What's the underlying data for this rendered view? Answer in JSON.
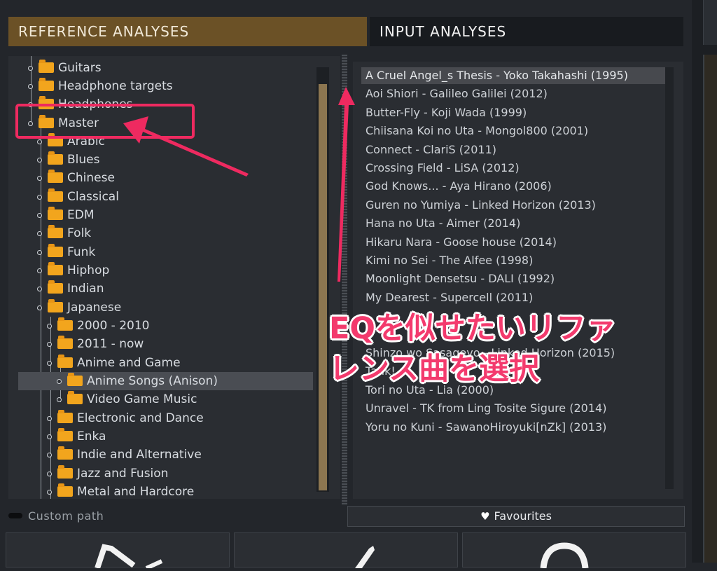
{
  "tabs": {
    "reference": "REFERENCE ANALYSES",
    "input": "INPUT ANALYSES"
  },
  "tree": {
    "items": [
      {
        "label": "Guitars"
      },
      {
        "label": "Headphone targets"
      },
      {
        "label": "Headphones"
      },
      {
        "label": "Master"
      },
      {
        "label": "Arabic"
      },
      {
        "label": "Blues"
      },
      {
        "label": "Chinese"
      },
      {
        "label": "Classical"
      },
      {
        "label": "EDM"
      },
      {
        "label": "Folk"
      },
      {
        "label": "Funk"
      },
      {
        "label": "Hiphop"
      },
      {
        "label": "Indian"
      },
      {
        "label": "Japanese"
      },
      {
        "label": "2000 - 2010"
      },
      {
        "label": "2011 - now"
      },
      {
        "label": "Anime and Game"
      },
      {
        "label": "Anime Songs (Anison)"
      },
      {
        "label": "Video Game Music"
      },
      {
        "label": "Electronic and Dance"
      },
      {
        "label": "Enka"
      },
      {
        "label": "Indie and Alternative"
      },
      {
        "label": "Jazz and Fusion"
      },
      {
        "label": "Metal and Hardcore"
      }
    ]
  },
  "songs": [
    "A Cruel Angel_s Thesis - Yoko Takahashi (1995)",
    "Aoi Shiori - Galileo Galilei (2012)",
    "Butter-Fly - Koji Wada (1999)",
    "Chiisana Koi no Uta - Mongol800 (2001)",
    "Connect - ClariS (2011)",
    "Crossing Field - LiSA (2012)",
    "God Knows... - Aya Hirano (2006)",
    "Guren no Yumiya - Linked Horizon (2013)",
    "Hana no Uta - Aimer (2014)",
    "Hikaru Nara - Goose house (2014)",
    "Kimi no Sei - The Alfee (1998)",
    "Moonlight Densetsu - DALI (1992)",
    "My Dearest - Supercell (2011)",
    "",
    "",
    "Shinzo wo Sasageyo - Linked Horizon (2015)",
    "Tank! - ",
    "Tori no Uta - Lia (2000)",
    "Unravel - TK from Ling Tosite Sigure (2014)",
    "Yoru no Kuni - SawanoHiroyuki[nZk] (2013)"
  ],
  "footer": {
    "custom_path": "Custom path",
    "favourites": "Favourites"
  },
  "annotation": {
    "line1": "EQを似せたいリファ",
    "line2": "レンス曲を選択"
  },
  "icons": {
    "heart": "heart-icon",
    "folder": "folder-icon"
  },
  "colors": {
    "accent_tab": "#6b5126",
    "annotation": "#ee2a60",
    "folder": "#f2a51d"
  }
}
